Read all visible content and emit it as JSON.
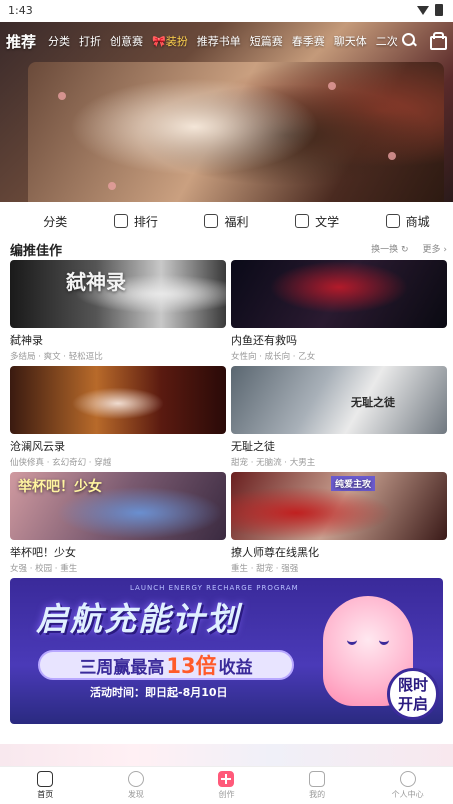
{
  "status_bar": {
    "time": "1:43"
  },
  "top_nav": {
    "tabs": [
      {
        "label": "推荐",
        "active": true
      },
      {
        "label": "分类"
      },
      {
        "label": "打折"
      },
      {
        "label": "创意赛"
      },
      {
        "label": "🎀装扮",
        "highlight": true
      },
      {
        "label": "推荐书单"
      },
      {
        "label": "短篇赛"
      },
      {
        "label": "春季赛"
      },
      {
        "label": "聊天体"
      },
      {
        "label": "二次"
      }
    ],
    "icons": [
      "search-icon",
      "bag-icon"
    ]
  },
  "categories": [
    {
      "label": "分类",
      "icon": "grid-icon"
    },
    {
      "label": "排行",
      "icon": "bar-chart-icon"
    },
    {
      "label": "福利",
      "icon": "coupon-icon"
    },
    {
      "label": "文学",
      "icon": "gift-icon"
    },
    {
      "label": "商城",
      "icon": "store-icon"
    }
  ],
  "section": {
    "title": "编推佳作",
    "refresh_label": "换一换 ↻",
    "more_label": "更多 ›"
  },
  "books": [
    {
      "title": "弑神录",
      "tags": "多结局 · 爽文 · 轻松逗比",
      "cover_text": "弑神录"
    },
    {
      "title": "内鱼还有救吗",
      "tags": "女性向 · 成长向 · 乙女",
      "cover_text": ""
    },
    {
      "title": "沧澜风云录",
      "tags": "仙侠修真 · 玄幻奇幻 · 穿越",
      "cover_text": ""
    },
    {
      "title": "无耻之徒",
      "tags": "甜宠 · 无脑流 · 大男主",
      "cover_text": "无耻之徒"
    },
    {
      "title": "举杯吧！少女",
      "tags": "女强 · 校园 · 重生",
      "cover_text": "举杯吧！少女"
    },
    {
      "title": "撩人师尊在线黑化",
      "tags": "重生 · 甜宠 · 强强",
      "cover_text": "纯爱主攻"
    }
  ],
  "promo": {
    "subtitle": "LAUNCH ENERGY RECHARGE PROGRAM",
    "title": "启航充能计划",
    "pill_prefix": "三周赢最高",
    "pill_big": "13倍",
    "pill_suffix": "收益",
    "time": "活动时间：即日起-8月10日",
    "badge_line1": "限时",
    "badge_line2": "开启"
  },
  "bottom_nav": [
    {
      "label": "首页",
      "active": true
    },
    {
      "label": "发现"
    },
    {
      "label": "创作"
    },
    {
      "label": "我的"
    },
    {
      "label": "个人中心"
    }
  ]
}
